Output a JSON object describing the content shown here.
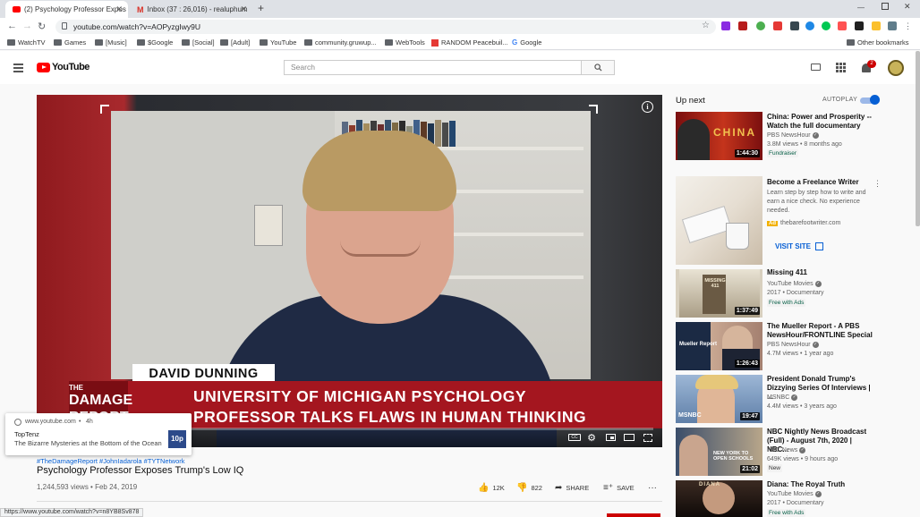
{
  "browser": {
    "tabs": [
      {
        "title": "(2) Psychology Professor Expos",
        "active": true
      },
      {
        "title": "Inbox (37 : 26,016) - realuphum",
        "active": false
      }
    ],
    "new_tab": "+",
    "url": "youtube.com/watch?v=AOPyzgIwy9U",
    "bookmarks": [
      "WatchTV",
      "Games",
      "[Music]",
      "$Google",
      "[Social]",
      "[Adult]",
      "YouTube",
      "community.gruwup...",
      "WebTools",
      "RANDOM Peacebuil...",
      "Google"
    ],
    "other_bookmarks": "Other bookmarks",
    "notification_count": "2",
    "status_url": "https://www.youtube.com/watch?v=n8YB8Sv878"
  },
  "header": {
    "logo_text": "YouTube",
    "search_placeholder": "Search"
  },
  "player": {
    "name_plate": "DAVID DUNNING",
    "show_logo_line1": "THE",
    "show_logo_line2": "DAMAGE",
    "show_logo_line3": "REPORT",
    "caption_line1": "UNIVERSITY OF MICHIGAN PSYCHOLOGY",
    "caption_line2": "PROFESSOR TALKS FLAWS IN HUMAN THINKING",
    "cc_label": "CC",
    "info_label": "i"
  },
  "video": {
    "hashtags": "#TheDamageReport #JohnIadarola #TYTNetwork",
    "title": "Psychology Professor Exposes Trump's Low IQ",
    "views_date": "1,244,593 views • Feb 24, 2019",
    "likes": "12K",
    "dislikes": "822",
    "share": "SHARE",
    "save": "SAVE"
  },
  "notification": {
    "source": "www.youtube.com",
    "age": "4h",
    "channel": "TopTenz",
    "text": "The Bizarre Mysteries at the Bottom of the Ocean",
    "icon_text": "10p"
  },
  "sidebar": {
    "up_next": "Up next",
    "autoplay": "AUTOPLAY",
    "items": [
      {
        "title": "China: Power and Prosperity -- Watch the full documentary",
        "channel": "PBS NewsHour",
        "meta": "3.8M views • 8 months ago",
        "badge": "Fundraiser",
        "duration": "1:44:30",
        "thumb_text": "CHINA"
      },
      {
        "title": "Become a Freelance Writer",
        "desc": "Learn step by step how to write and earn a nice check. No experience needed.",
        "ad_label": "Ad",
        "domain": "thebarefootwriter.com",
        "cta": "VISIT SITE"
      },
      {
        "title": "Missing 411",
        "channel": "YouTube Movies",
        "meta": "2017 • Documentary",
        "badge": "Free with Ads",
        "duration": "1:37:49",
        "thumb_text": "MISSING 411"
      },
      {
        "title": "The Mueller Report - A PBS NewsHour/FRONTLINE Special",
        "channel": "PBS NewsHour",
        "meta": "4.7M views • 1 year ago",
        "duration": "1:26:43",
        "thumb_text": "Mueller Report"
      },
      {
        "title": "President Donald Trump's Dizzying Series Of Interviews | ...",
        "channel": "MSNBC",
        "meta": "4.4M views • 3 years ago",
        "duration": "19:47",
        "thumb_text": "MSNBC"
      },
      {
        "title": "NBC Nightly News Broadcast (Full) - August 7th, 2020 | NBC...",
        "channel": "NBC News",
        "meta": "649K views • 9 hours ago",
        "badge": "New",
        "duration": "21:02",
        "thumb_text": "NEW YORK TO OPEN SCHOOLS"
      },
      {
        "title": "Diana: The Royal Truth",
        "channel": "YouTube Movies",
        "meta": "2017 • Documentary",
        "badge": "Free with Ads",
        "thumb_text": "DIANA"
      }
    ]
  }
}
